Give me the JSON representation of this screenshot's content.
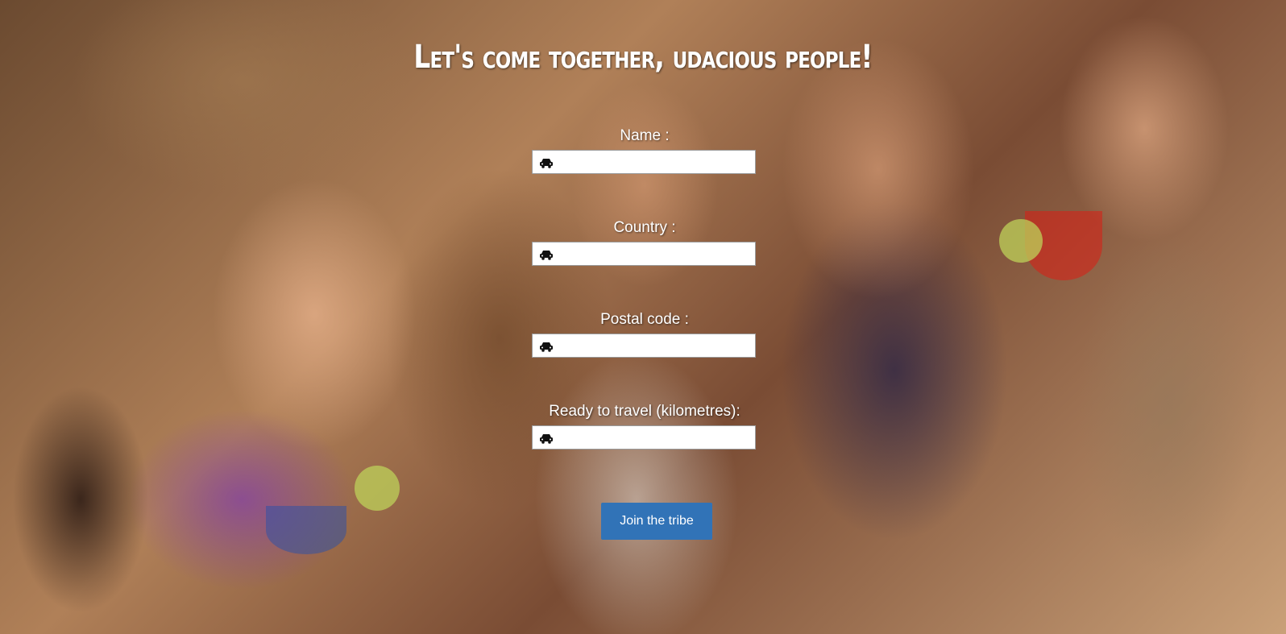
{
  "page": {
    "title": "Let's come together, udacious people!"
  },
  "form": {
    "fields": [
      {
        "label": "Name :",
        "value": "",
        "icon": "car-icon"
      },
      {
        "label": "Country :",
        "value": "",
        "icon": "car-icon"
      },
      {
        "label": "Postal code :",
        "value": "",
        "icon": "car-icon"
      },
      {
        "label": "Ready to travel (kilometres):",
        "value": "",
        "icon": "car-icon"
      }
    ],
    "submit_label": "Join the tribe"
  },
  "colors": {
    "button": "#3173b7",
    "text": "#ffffff"
  }
}
